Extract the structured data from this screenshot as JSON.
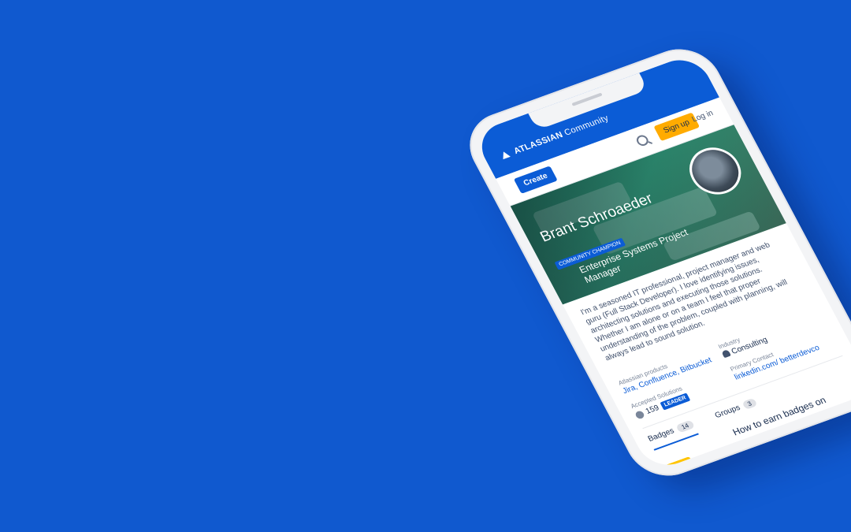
{
  "header": {
    "brand": "ATLASSIAN",
    "product": "Community",
    "search_icon": "search-icon"
  },
  "toolbar": {
    "create_label": "Create",
    "signup_label": "Sign up",
    "login_label": "Log in"
  },
  "profile": {
    "name": "Brant Schroaeder",
    "badge": "COMMUNITY CHAMPION",
    "role": "Enterprise Systems Project Manager",
    "bio": "I'm a seasoned IT professional, project manager and web guru (Full Stack Developer). I love identifying issues, architecting solutions and executing those solutions. Whether I am alone or on a team I feel that proper understanding of the problem, coupled with planning, will always lead to sound solution."
  },
  "meta": {
    "industry_label": "Industry",
    "industry_value": "Consulting",
    "products_label": "Atlassian products",
    "products_value": "Jira, Confluence, Bitbucket",
    "contact_label": "Primary Contact",
    "contact_value": "linkedin.com/ betterdevco",
    "solutions_label": "Accepted Solutions",
    "solutions_value": "159",
    "solutions_badge": "LEADER"
  },
  "tabs": [
    {
      "label": "Badges",
      "count": "14"
    },
    {
      "label": "Groups",
      "count": "3"
    }
  ],
  "earn_text": "How to earn badges on",
  "colors": {
    "background": "#1059cf",
    "primary": "#0b5cd6",
    "signup": "#ffab00"
  }
}
